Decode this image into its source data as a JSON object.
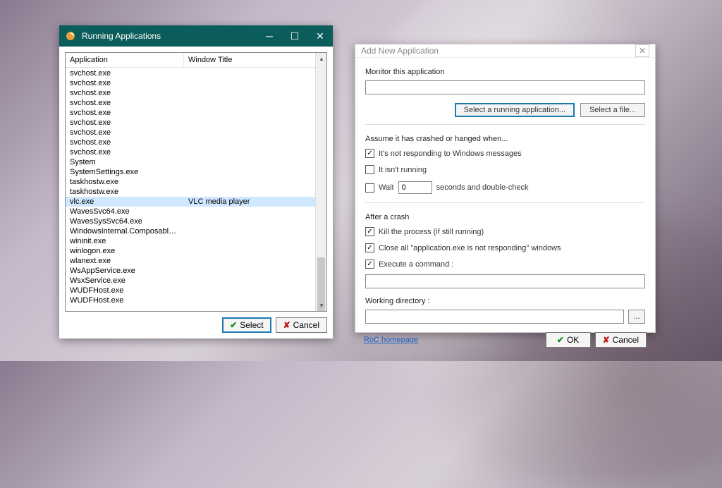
{
  "win1": {
    "title": "Running Applications",
    "columns": {
      "app": "Application",
      "wintitle": "Window Title"
    },
    "rows": [
      {
        "app": "svchost.exe",
        "title": ""
      },
      {
        "app": "svchost.exe",
        "title": ""
      },
      {
        "app": "svchost.exe",
        "title": ""
      },
      {
        "app": "svchost.exe",
        "title": ""
      },
      {
        "app": "svchost.exe",
        "title": ""
      },
      {
        "app": "svchost.exe",
        "title": ""
      },
      {
        "app": "svchost.exe",
        "title": ""
      },
      {
        "app": "svchost.exe",
        "title": ""
      },
      {
        "app": "svchost.exe",
        "title": ""
      },
      {
        "app": "System",
        "title": ""
      },
      {
        "app": "SystemSettings.exe",
        "title": ""
      },
      {
        "app": "taskhostw.exe",
        "title": ""
      },
      {
        "app": "taskhostw.exe",
        "title": ""
      },
      {
        "app": "vlc.exe",
        "title": "VLC media player",
        "selected": true
      },
      {
        "app": "WavesSvc64.exe",
        "title": ""
      },
      {
        "app": "WavesSysSvc64.exe",
        "title": ""
      },
      {
        "app": "WindowsInternal.ComposableShell.E...",
        "title": ""
      },
      {
        "app": "wininit.exe",
        "title": ""
      },
      {
        "app": "winlogon.exe",
        "title": ""
      },
      {
        "app": "wlanext.exe",
        "title": ""
      },
      {
        "app": "WsAppService.exe",
        "title": ""
      },
      {
        "app": "WsxService.exe",
        "title": ""
      },
      {
        "app": "WUDFHost.exe",
        "title": ""
      },
      {
        "app": "WUDFHost.exe",
        "title": ""
      }
    ],
    "select_label": "Select",
    "cancel_label": "Cancel"
  },
  "win2": {
    "title": "Add New Application",
    "monitor_label": "Monitor this application",
    "monitor_value": "",
    "select_running_label": "Select a running application...",
    "select_file_label": "Select a file...",
    "assume_label": "Assume it has crashed or hanged when...",
    "chk_not_responding": {
      "checked": true,
      "label": "It's not responding to Windows messages"
    },
    "chk_not_running": {
      "checked": false,
      "label": "It isn't running"
    },
    "chk_wait": {
      "checked": false,
      "label": "Wait",
      "value": "0",
      "suffix": "seconds and double-check"
    },
    "after_crash_label": "After a crash",
    "chk_kill": {
      "checked": true,
      "label": "Kill the process (if still running)"
    },
    "chk_close_all": {
      "checked": true,
      "label": "Close all \"application.exe is not responding\" windows"
    },
    "chk_exec": {
      "checked": true,
      "label": "Execute a command :"
    },
    "exec_value": "",
    "workdir_label": "Working directory :",
    "workdir_value": "",
    "dirbtn_label": "...",
    "homepage_label": "RoC homepage",
    "ok_label": "OK",
    "cancel_label": "Cancel"
  }
}
